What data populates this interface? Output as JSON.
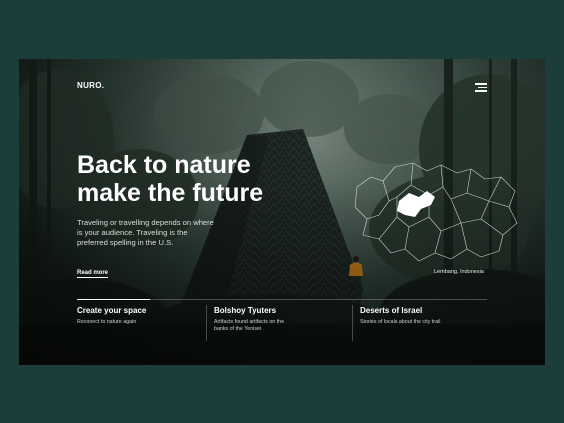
{
  "brand": {
    "logo": "NURO."
  },
  "hero": {
    "headline_line1": "Back to nature",
    "headline_line2": "make the future",
    "intro": "Traveling or travelling depends on where is your audience. Traveling is the preferred spelling in the U.S.",
    "cta": "Read more"
  },
  "map": {
    "caption": "Lembang, Indonesia"
  },
  "cards": [
    {
      "title": "Create your space",
      "text": "Reconect to nature again"
    },
    {
      "title": "Bolshoy Tyuters",
      "text": "Artifacts found artifacts on the banks of the Yenisei"
    },
    {
      "title": "Deserts of Israel",
      "text": "Stories of locals about the city trail"
    }
  ],
  "colors": {
    "page_bg": "#1c3d39",
    "text": "#ffffff",
    "map_highlight": "#ffffff",
    "hiker_jacket": "#d88a1d"
  },
  "icons": {
    "menu": "hamburger-menu-icon"
  }
}
